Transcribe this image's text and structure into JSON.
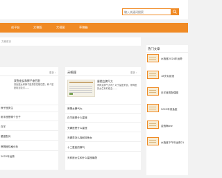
{
  "search": {
    "placeholder": "输入关键词搜索",
    "button_icon": "search-icon"
  },
  "nav": {
    "items": [
      {
        "label": "创平台"
      },
      {
        "label": "文稿版"
      },
      {
        "label": "大视图"
      },
      {
        "label": "草稿箱"
      }
    ]
  },
  "strip": {
    "text": "文稿首页"
  },
  "left_panel": {
    "title": "",
    "more": "更多 ›",
    "featured": {
      "title": "双鱼座女和狮子座匹配",
      "desc": "双鱼座女和狮子座男的性格匹配，两个星座相互吸引……"
    },
    "list": [
      "狮子座男生",
      "射手座是哪个日子",
      "白羊",
      "星座配对",
      "摩羯座性格分析",
      "2022年运势"
    ]
  },
  "mid_panel": {
    "title": "天蝎座",
    "more": "更多 ›",
    "featured": {
      "title": "摩羯女脾气大",
      "desc": "摩羯女脾气大吗？对于星座来说，摩羯座的女生有时候会……"
    },
    "list": [
      "摩羯女脾气大",
      "白羊座是什么星座",
      "天蝎座是什么星座",
      "天蝎男怎么挽回双鱼女",
      "十二星座的脾气",
      "天秤座女生和什么星座最配"
    ]
  },
  "right_panel": {
    "title": "热门文章",
    "items": [
      {
        "title": "水瓶座2024年运势"
      },
      {
        "title": "18岁女孩漫"
      },
      {
        "title": "白羊座男配偶图"
      },
      {
        "title": "2022年双鱼座"
      },
      {
        "title": "金瓶梅ww"
      },
      {
        "title": "水瓶座下午年运势21"
      }
    ]
  },
  "colors": {
    "accent": "#f08a24",
    "page_bg": "#f2f2f2"
  }
}
